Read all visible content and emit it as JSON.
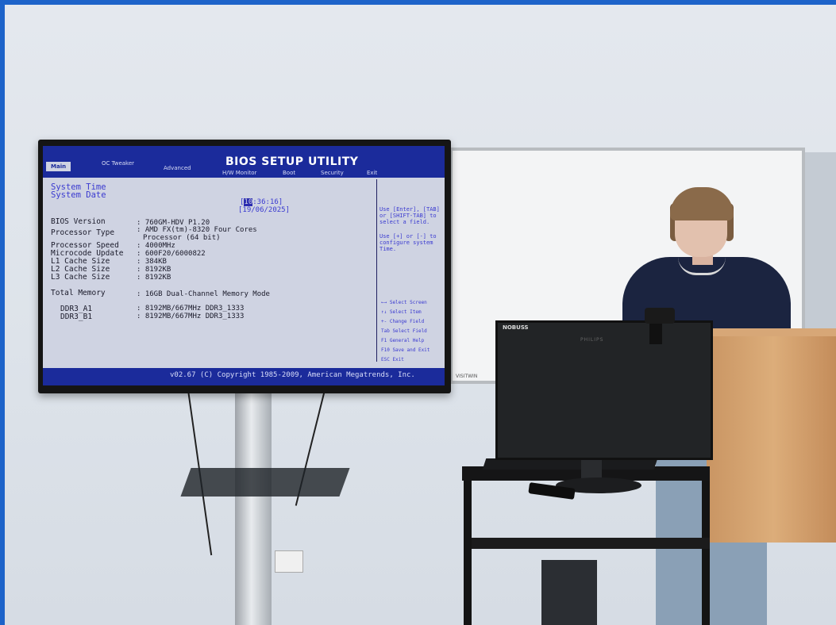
{
  "bios": {
    "title": "BIOS SETUP UTILITY",
    "tabs": [
      "Main",
      "OC Tweaker",
      "Advanced",
      "H/W Monitor",
      "Boot",
      "Security",
      "Exit"
    ],
    "system_time_label": "System Time",
    "system_date_label": "System Date",
    "time_hour": "10",
    "time_rest": ":36:16]",
    "time_open": "[",
    "date_value": "[19/06/2025]",
    "rows": [
      {
        "label": "BIOS Version",
        "value": ": 760GM-HDV P1.20"
      },
      {
        "label": "Processor Type",
        "value": ": AMD FX(tm)-8320 Four Cores"
      },
      {
        "label": "",
        "value": "Processor (64 bit)"
      },
      {
        "label": "Processor Speed",
        "value": ": 4000MHz"
      },
      {
        "label": "Microcode Update",
        "value": ": 600F20/6000822"
      },
      {
        "label": "L1 Cache Size",
        "value": ": 384KB"
      },
      {
        "label": "L2 Cache Size",
        "value": ": 8192KB"
      },
      {
        "label": "L3 Cache Size",
        "value": ": 8192KB"
      },
      {
        "label": "Total Memory",
        "value": ": 16GB Dual-Channel Memory Mode"
      },
      {
        "label": "DDR3_A1",
        "value": ": 8192MB/667MHz DDR3_1333"
      },
      {
        "label": "DDR3_B1",
        "value": ": 8192MB/667MHz DDR3_1333"
      }
    ],
    "help": [
      "Use [Enter], [TAB]",
      "or [SHIFT-TAB] to",
      "select a field.",
      "",
      "Use [+] or [-] to",
      "configure system",
      "Time."
    ],
    "keys": [
      "←→  Select Screen",
      "↑↓  Select Item",
      "+-  Change Field",
      "Tab Select Field",
      "F1  General Help",
      "F10 Save and Exit",
      "ESC Exit"
    ],
    "copyright": "v02.67 (C) Copyright 1985-2009, American Megatrends, Inc."
  },
  "monitor": {
    "brand": "NOBUSS",
    "logo": "PHILIPS"
  },
  "whiteboard": {
    "brand": "VISITWIN"
  },
  "colors": {
    "frame": "#1d63c9",
    "bios_bg": "#cfd3e2",
    "bios_bar": "#1b2b9b"
  }
}
